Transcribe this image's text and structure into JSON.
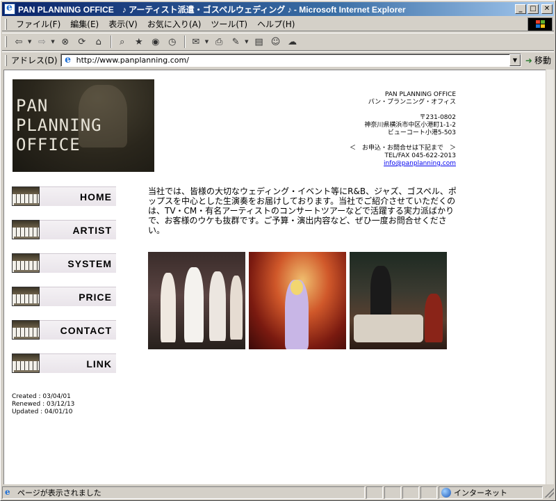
{
  "window": {
    "title": "PAN PLANNING OFFICE　♪ アーティスト派遣・ゴスペルウェディング ♪ - Microsoft Internet Explorer"
  },
  "menubar": {
    "items": [
      "ファイル(F)",
      "編集(E)",
      "表示(V)",
      "お気に入り(A)",
      "ツール(T)",
      "ヘルプ(H)"
    ]
  },
  "toolbar": {
    "buttons": [
      "back-icon",
      "forward-icon",
      "stop-icon",
      "refresh-icon",
      "home-icon",
      "search-icon",
      "favorites-icon",
      "media-icon",
      "history-icon",
      "mail-icon",
      "print-icon",
      "edit-icon",
      "discuss-icon",
      "messenger-icon",
      "messenger-chat-icon"
    ]
  },
  "addressbar": {
    "label": "アドレス(D)",
    "url": "http://www.panplanning.com/",
    "go_label": "移動"
  },
  "page": {
    "logo_lines": [
      "PAN",
      "PLANNING",
      "OFFICE"
    ],
    "company": {
      "name_en": "PAN PLANNING OFFICE",
      "name_ja": "パン・プランニング・オフィス",
      "postal": "〒231-0802",
      "address1": "神奈川県横浜市中区小港町1-1-2",
      "address2": "ビューコート小港5-503",
      "inquiry": "＜　お申込・お問合せは下記まで　＞",
      "telfax": "TEL/FAX 045-622-2013",
      "email": "info@panplanning.com"
    },
    "nav": [
      "HOME",
      "ARTIST",
      "SYSTEM",
      "PRICE",
      "CONTACT",
      "LINK"
    ],
    "dates": {
      "created": "Created : 03/04/01",
      "renewed": "Renewed : 03/12/13",
      "updated": "Updated : 04/01/10"
    },
    "intro": "当社では、皆様の大切なウェディング・イベント等にR&B、ジャズ、ゴスペル、ポップスを中心とした生演奏をお届けしております。当社でご紹介させていただくのは、TV・CM・有名アーティストのコンサートツアーなどで活躍する実力派ばかりで、お客様のウケも抜群です。ご予算・演出内容など、ぜひ一度お問合せください。"
  },
  "statusbar": {
    "text": "ページが表示されました",
    "zone": "インターネット"
  },
  "colors": {
    "titlebar_start": "#0a246a",
    "titlebar_end": "#a6caf0",
    "link": "#0000ee",
    "chrome": "#d4d0c8"
  }
}
